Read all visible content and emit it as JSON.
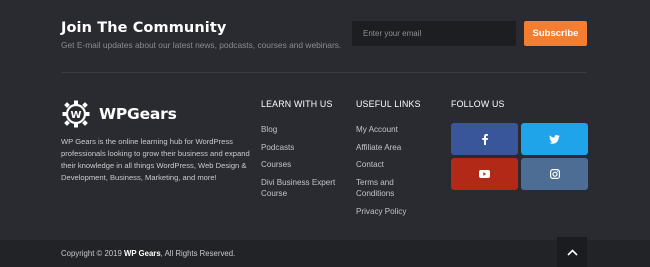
{
  "newsletter": {
    "title": "Join The Community",
    "subtitle": "Get E-mail updates about our latest news, podcasts, courses and webinars.",
    "email_placeholder": "Enter your email",
    "subscribe_label": "Subscribe"
  },
  "brand": {
    "logo_text": "WPGears",
    "description": "WP Gears is the online learning hub for WordPress professionals looking to grow their business and expand their knowledge in all things WordPress, Web Design & Development, Business, Marketing, and more!"
  },
  "learn": {
    "heading": "LEARN WITH US",
    "items": [
      "Blog",
      "Podcasts",
      "Courses",
      "Divi Business Expert Course"
    ]
  },
  "useful": {
    "heading": "USEFUL LINKS",
    "items": [
      "My Account",
      "Affiliate Area",
      "Contact",
      "Terms and Conditions",
      "Privacy Policy"
    ]
  },
  "follow": {
    "heading": "FOLLOW US",
    "icons": [
      "facebook-icon",
      "twitter-icon",
      "youtube-icon",
      "instagram-icon"
    ],
    "colors": {
      "facebook": "#3a569b",
      "twitter": "#1fa3e9",
      "youtube": "#b32918",
      "instagram": "#4d6d95"
    }
  },
  "footer": {
    "copyright_prefix": "Copyright © 2019",
    "copyright_brand": "WP Gears",
    "copyright_suffix": ", All Rights Reserved."
  },
  "colors": {
    "accent": "#f47d30",
    "background": "#2a2b30"
  }
}
